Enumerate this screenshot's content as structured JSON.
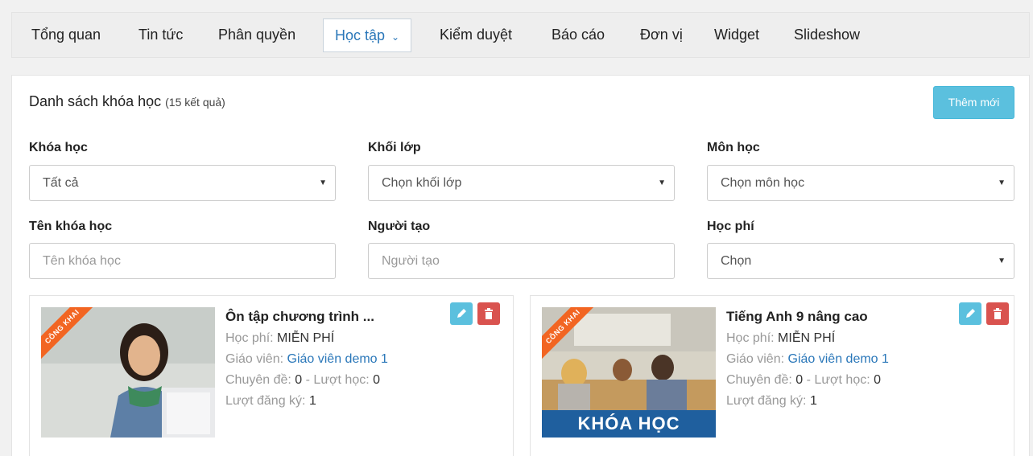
{
  "nav": {
    "items": [
      "Tổng quan",
      "Tin tức",
      "Phân quyền",
      "Học tập",
      "Kiểm duyệt",
      "Báo cáo",
      "Đơn vị",
      "Widget",
      "Slideshow"
    ]
  },
  "header": {
    "title": "Danh sách khóa học",
    "count": "(15 kết quả)",
    "add_label": "Thêm mới"
  },
  "filters": {
    "course_label": "Khóa học",
    "course_value": "Tất cả",
    "grade_label": "Khối lớp",
    "grade_value": "Chọn khối lớp",
    "subject_label": "Môn học",
    "subject_value": "Chọn môn học",
    "name_label": "Tên khóa học",
    "name_placeholder": "Tên khóa học",
    "creator_label": "Người tạo",
    "creator_placeholder": "Người tạo",
    "fee_label": "Học phí",
    "fee_value": "Chọn"
  },
  "cards": [
    {
      "ribbon": "CÔNG KHAI",
      "title": "Ôn tập chương trình ...",
      "fee_label": "Học phí:",
      "fee_value": "MIỄN PHÍ",
      "teacher_label": "Giáo viên:",
      "teacher_value": "Giáo viên demo 1",
      "topics_label": "Chuyên đề:",
      "topics_value": "0",
      "views_label": "- Lượt học:",
      "views_value": "0",
      "reg_label": "Lượt đăng ký:",
      "reg_value": "1"
    },
    {
      "ribbon": "CÔNG KHAI",
      "title": "Tiếng Anh 9 nâng cao",
      "banner": "KHÓA HỌC",
      "fee_label": "Học phí:",
      "fee_value": "MIỄN PHÍ",
      "teacher_label": "Giáo viên:",
      "teacher_value": "Giáo viên demo 1",
      "topics_label": "Chuyên đề:",
      "topics_value": "0",
      "views_label": "- Lượt học:",
      "views_value": "0",
      "reg_label": "Lượt đăng ký:",
      "reg_value": "1"
    }
  ],
  "colors": {
    "accent": "#2a77b9",
    "info": "#5bc0de",
    "danger": "#d9534f",
    "ribbon": "#f26522",
    "banner": "#1f5f9e"
  }
}
